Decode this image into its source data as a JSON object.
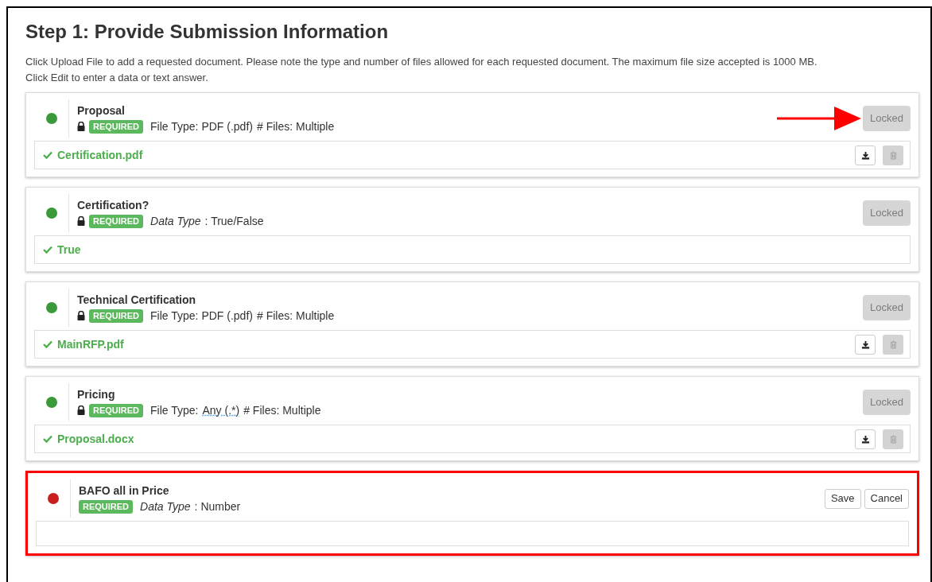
{
  "heading": "Step 1: Provide Submission Information",
  "instructions": [
    "Click Upload File to add a requested document. Please note the type and number of files allowed for each requested document. The maximum file size accepted is 1000 MB.",
    "Click Edit to enter a data or text answer."
  ],
  "items": [
    {
      "title": "Proposal",
      "color": "#3a9a3a",
      "locked": true,
      "badge": "REQUIRED",
      "meta": [
        {
          "kind": "plain",
          "text": "File Type: PDF (.pdf)"
        },
        {
          "kind": "plain",
          "text": "# Files: Multiple"
        }
      ],
      "action": {
        "kind": "locked",
        "label": "Locked"
      },
      "pointer_arrow": true,
      "highlighted": false,
      "answer": {
        "kind": "file",
        "text": "Certification.pdf"
      }
    },
    {
      "title": "Certification?",
      "color": "#3a9a3a",
      "locked": true,
      "badge": "REQUIRED",
      "meta": [
        {
          "kind": "italic",
          "text": "Data Type"
        },
        {
          "kind": "plain",
          "text": ":  True/False"
        }
      ],
      "action": {
        "kind": "locked",
        "label": "Locked"
      },
      "pointer_arrow": false,
      "highlighted": false,
      "answer": {
        "kind": "value",
        "text": "True"
      }
    },
    {
      "title": "Technical Certification",
      "color": "#3a9a3a",
      "locked": true,
      "badge": "REQUIRED",
      "meta": [
        {
          "kind": "plain",
          "text": "File Type: PDF (.pdf)"
        },
        {
          "kind": "plain",
          "text": "# Files: Multiple"
        }
      ],
      "action": {
        "kind": "locked",
        "label": "Locked"
      },
      "pointer_arrow": false,
      "highlighted": false,
      "answer": {
        "kind": "file",
        "text": "MainRFP.pdf"
      }
    },
    {
      "title": "Pricing",
      "color": "#3a9a3a",
      "locked": true,
      "badge": "REQUIRED",
      "meta": [
        {
          "kind": "plain",
          "text": "File Type:"
        },
        {
          "kind": "abbr",
          "text": "Any (.*)"
        },
        {
          "kind": "plain",
          "text": "# Files: Multiple"
        }
      ],
      "action": {
        "kind": "locked",
        "label": "Locked"
      },
      "pointer_arrow": false,
      "highlighted": false,
      "answer": {
        "kind": "file",
        "text": "Proposal.docx"
      }
    },
    {
      "title": "BAFO all in Price",
      "color": "#c81e1e",
      "locked": false,
      "badge": "REQUIRED",
      "meta": [
        {
          "kind": "italic",
          "text": "Data Type"
        },
        {
          "kind": "plain",
          "text": ":  Number"
        }
      ],
      "action": {
        "kind": "edit",
        "buttons": [
          "Save",
          "Cancel"
        ]
      },
      "pointer_arrow": false,
      "highlighted": true,
      "answer": {
        "kind": "input"
      }
    }
  ]
}
